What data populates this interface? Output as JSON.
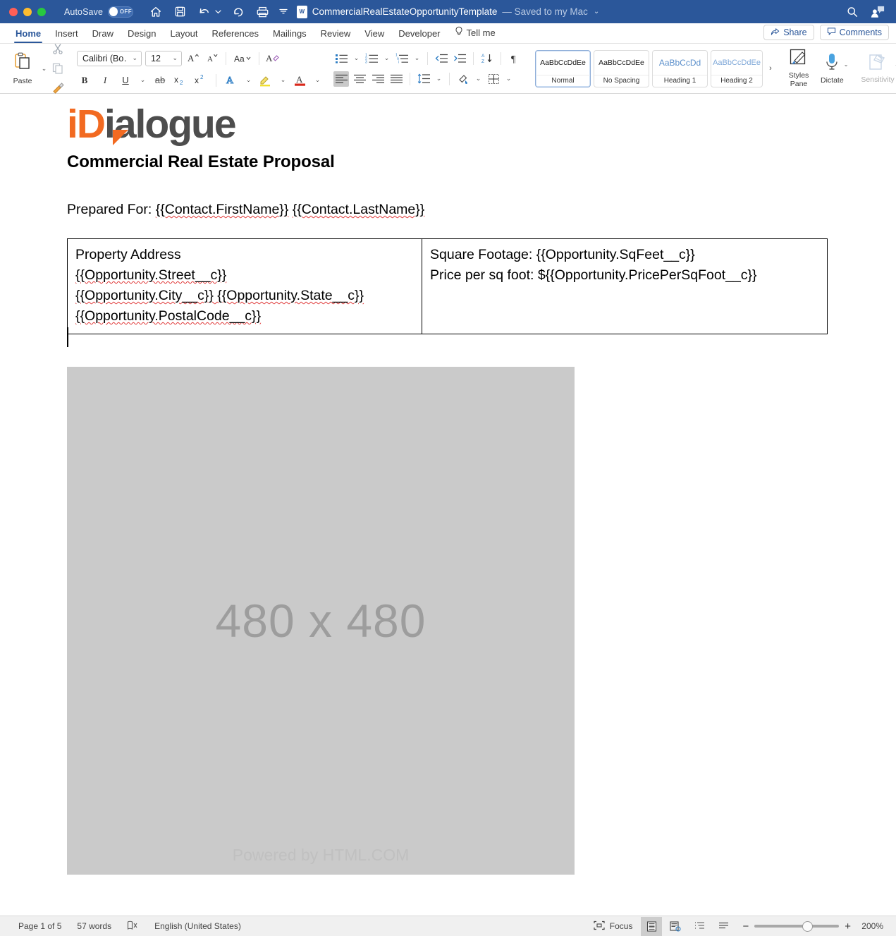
{
  "window": {
    "autosave_label": "AutoSave",
    "autosave_state": "OFF",
    "doc_title": "CommercialRealEstateOpportunityTemplate",
    "doc_status": "— Saved to my Mac",
    "title_chevron": "⌄",
    "titlebar_color": "#2b579a",
    "quick_access": [
      {
        "name": "home-icon",
        "label": "Home"
      },
      {
        "name": "save-icon",
        "label": "Save"
      },
      {
        "name": "undo-icon",
        "label": "Undo"
      },
      {
        "name": "undo-dropdown-icon",
        "label": "Undo options"
      },
      {
        "name": "redo-icon",
        "label": "Redo"
      },
      {
        "name": "print-icon",
        "label": "Print"
      },
      {
        "name": "customize-toolbar-icon",
        "label": "Customize"
      }
    ],
    "right_icons": [
      {
        "name": "search-icon",
        "label": "Search"
      },
      {
        "name": "account-icon",
        "label": "Account"
      }
    ]
  },
  "ribbon_tabs": {
    "items": [
      {
        "label": "Home",
        "active": true
      },
      {
        "label": "Insert",
        "active": false
      },
      {
        "label": "Draw",
        "active": false
      },
      {
        "label": "Design",
        "active": false
      },
      {
        "label": "Layout",
        "active": false
      },
      {
        "label": "References",
        "active": false
      },
      {
        "label": "Mailings",
        "active": false
      },
      {
        "label": "Review",
        "active": false
      },
      {
        "label": "View",
        "active": false
      },
      {
        "label": "Developer",
        "active": false
      }
    ],
    "tell_me": "Tell me",
    "share": "Share",
    "comments": "Comments"
  },
  "ribbon": {
    "paste_label": "Paste",
    "font_name": "Calibri (Bo…",
    "font_size": "12",
    "styles": [
      {
        "preview": "AaBbCcDdEe",
        "name": "Normal",
        "selected": true,
        "kind": "normal"
      },
      {
        "preview": "AaBbCcDdEe",
        "name": "No Spacing",
        "selected": false,
        "kind": "normal"
      },
      {
        "preview": "AaBbCcDd",
        "name": "Heading 1",
        "selected": false,
        "kind": "h1"
      },
      {
        "preview": "AaBbCcDdEe",
        "name": "Heading 2",
        "selected": false,
        "kind": "h2"
      }
    ],
    "gallery_more": "›",
    "styles_pane_label": "Styles\nPane",
    "styles_pane_line1": "Styles",
    "styles_pane_line2": "Pane",
    "dictate_label": "Dictate",
    "sensitivity_label": "Sensitivity"
  },
  "document": {
    "logo_orange": "iD",
    "logo_gray": "ialogue",
    "logo_orange_color": "#f26a21",
    "logo_gray_color": "#4d4d4d",
    "heading": "Commercial Real Estate Proposal",
    "prepared_for": "Prepared For: {{Contact.FirstName}} {{Contact.LastName}}",
    "table": {
      "left_cell": [
        "Property Address",
        "{{Opportunity.Street__c}}",
        "{{Opportunity.City__c}} {{Opportunity.State__c}}",
        "{{Opportunity.PostalCode__c}}"
      ],
      "right_cell": [
        "Square Footage: {{Opportunity.SqFeet__c}}",
        "Price per sq foot: ${{Opportunity.PricePerSqFoot__c}}"
      ]
    },
    "image_placeholder": {
      "dimensions": "480 x 480",
      "credit": "Powered by HTML.COM",
      "background": "#cacaca"
    }
  },
  "status_bar": {
    "page": "Page 1 of 5",
    "words": "57 words",
    "proofing_icon": "proofing-errors-icon",
    "language": "English (United States)",
    "focus": "Focus",
    "views": [
      {
        "name": "print-layout-view-button",
        "active": true
      },
      {
        "name": "web-layout-view-button",
        "active": false
      },
      {
        "name": "outline-view-button",
        "active": false
      },
      {
        "name": "draft-view-button",
        "active": false
      }
    ],
    "zoom_out": "−",
    "zoom_in": "+",
    "zoom_level": "200%"
  }
}
